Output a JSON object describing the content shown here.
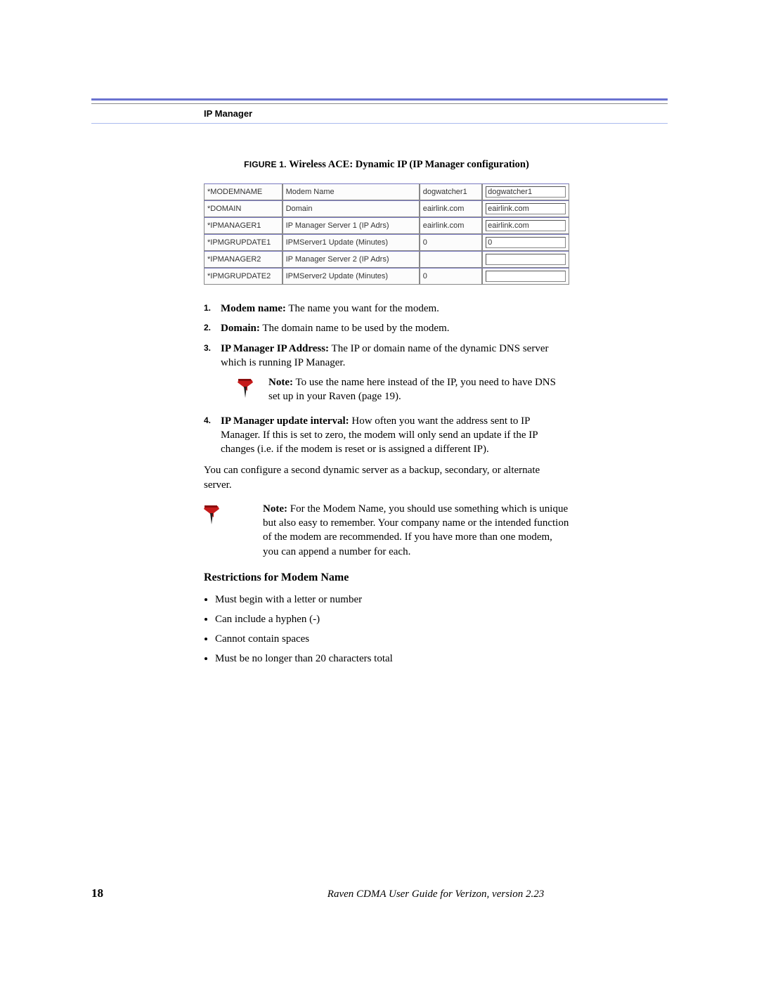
{
  "header": {
    "running_head": "IP Manager"
  },
  "figure": {
    "label": "FIGURE 1.",
    "title": "Wireless ACE: Dynamic IP (IP Manager configuration)"
  },
  "config_rows": [
    {
      "param": "*MODEMNAME",
      "desc": "Modem Name",
      "value": "dogwatcher1",
      "input": "dogwatcher1"
    },
    {
      "param": "*DOMAIN",
      "desc": "Domain",
      "value": "eairlink.com",
      "input": "eairlink.com"
    },
    {
      "param": "*IPMANAGER1",
      "desc": "IP Manager Server 1 (IP Adrs)",
      "value": "eairlink.com",
      "input": "eairlink.com"
    },
    {
      "param": "*IPMGRUPDATE1",
      "desc": "IPMServer1 Update (Minutes)",
      "value": "0",
      "input": "0"
    },
    {
      "param": "*IPMANAGER2",
      "desc": "IP Manager Server 2 (IP Adrs)",
      "value": "",
      "input": ""
    },
    {
      "param": "*IPMGRUPDATE2",
      "desc": "IPMServer2 Update (Minutes)",
      "value": "0",
      "input": ""
    }
  ],
  "instructions": {
    "i1": {
      "num": "1.",
      "term": "Modem name:",
      "text": " The name you want for the modem."
    },
    "i2": {
      "num": "2.",
      "term": "Domain:",
      "text": " The domain name to be used by the modem."
    },
    "i3": {
      "num": "3.",
      "term": "IP Manager IP Address:",
      "text": " The IP or domain name of the dynamic DNS server which is running IP Manager."
    },
    "i4": {
      "num": "4.",
      "term": "IP Manager update interval:",
      "text": " How often you want the address sent to IP Manager. If this is set to zero, the modem will only send an update if the IP changes (i.e. if the modem is reset or is assigned a different IP)."
    }
  },
  "notes": {
    "note1": {
      "prefix": "Note:",
      "text": " To use the name here instead of the IP, you need to have DNS set up in your Raven (page 19)."
    },
    "note2": {
      "prefix": "Note:",
      "text": " For the Modem Name, you should use something which is unique but also easy to remember.  Your company name or the intended function of the modem are recommended.  If you have more than one modem, you can append a number for each."
    }
  },
  "body": {
    "p1": "You can configure a second dynamic server as a backup, secondary, or alternate server."
  },
  "restrictions": {
    "heading": "Restrictions for Modem Name",
    "items": [
      "Must begin with a letter or number",
      "Can include a hyphen (-)",
      "Cannot contain spaces",
      "Must be no longer than 20 characters total"
    ]
  },
  "footer": {
    "page_number": "18",
    "doc_title": "Raven CDMA User Guide for Verizon, version 2.23"
  }
}
